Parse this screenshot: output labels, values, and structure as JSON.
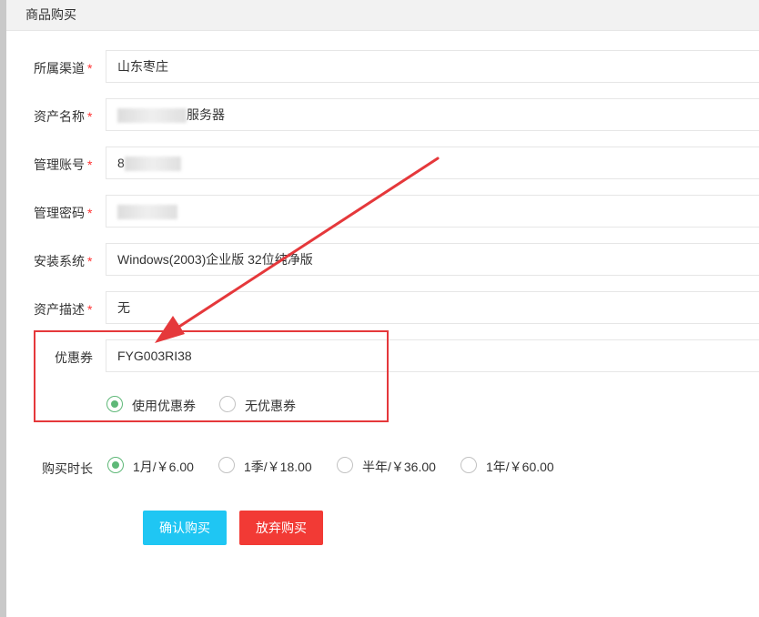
{
  "panel": {
    "title": "商品购买"
  },
  "form": {
    "required_mark": "*",
    "channel": {
      "label": "所属渠道",
      "value": "山东枣庄"
    },
    "asset_name": {
      "label": "资产名称",
      "value_suffix": "服务器"
    },
    "account": {
      "label": "管理账号",
      "value_prefix": "8"
    },
    "password": {
      "label": "管理密码"
    },
    "os": {
      "label": "安装系统",
      "value": "Windows(2003)企业版 32位纯净版"
    },
    "description": {
      "label": "资产描述",
      "value": "无"
    },
    "coupon": {
      "label": "优惠券",
      "value": "FYG003RI38",
      "options": [
        {
          "label": "使用优惠券",
          "checked": true
        },
        {
          "label": "无优惠券",
          "checked": false
        }
      ]
    },
    "duration": {
      "label": "购买时长",
      "options": [
        {
          "label": "1月/￥6.00",
          "checked": true
        },
        {
          "label": "1季/￥18.00",
          "checked": false
        },
        {
          "label": "半年/￥36.00",
          "checked": false
        },
        {
          "label": "1年/￥60.00",
          "checked": false
        }
      ]
    }
  },
  "buttons": {
    "confirm": "确认购买",
    "cancel": "放弃购买"
  },
  "colors": {
    "accent_green": "#5fb878",
    "confirm_bg": "#1fc6f3",
    "cancel_bg": "#f23a35",
    "annotation_red": "#e5383b"
  }
}
